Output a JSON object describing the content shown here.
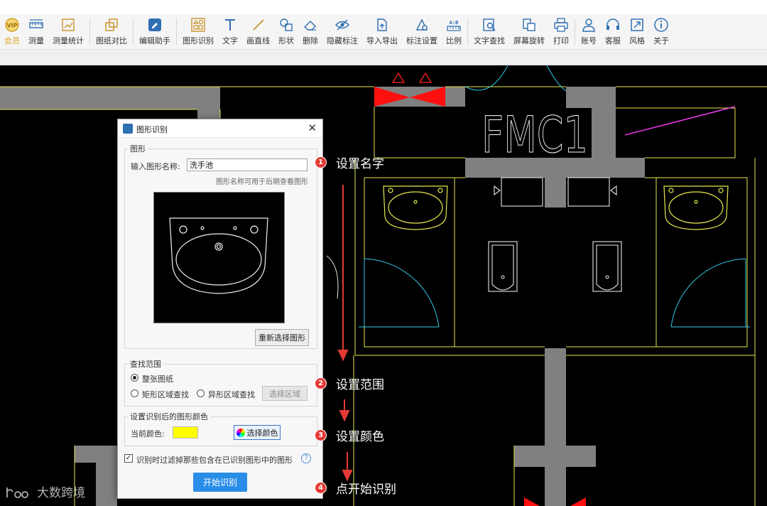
{
  "toolbar": {
    "items": [
      {
        "label": "会员",
        "icon": "vip-icon"
      },
      {
        "label": "测量",
        "icon": "measure-icon"
      },
      {
        "label": "测量统计",
        "icon": "measure-stats-icon"
      },
      {
        "label": "图纸对比",
        "icon": "compare-icon"
      },
      {
        "label": "编辑助手",
        "icon": "edit-assistant-icon"
      },
      {
        "label": "图形识别",
        "icon": "shape-recognition-icon"
      },
      {
        "label": "文字",
        "icon": "text-icon"
      },
      {
        "label": "画直线",
        "icon": "line-icon"
      },
      {
        "label": "形状",
        "icon": "shape-icon"
      },
      {
        "label": "删除",
        "icon": "eraser-icon"
      },
      {
        "label": "隐藏标注",
        "icon": "hide-icon"
      },
      {
        "label": "导入导出",
        "icon": "import-export-icon"
      },
      {
        "label": "标注设置",
        "icon": "annotation-settings-icon"
      },
      {
        "label": "比例",
        "icon": "scale-icon"
      },
      {
        "label": "文字查找",
        "icon": "text-search-icon"
      },
      {
        "label": "屏幕旋转",
        "icon": "rotate-screen-icon"
      },
      {
        "label": "打印",
        "icon": "print-icon"
      },
      {
        "label": "账号",
        "icon": "account-icon"
      },
      {
        "label": "客服",
        "icon": "headset-icon"
      },
      {
        "label": "风格",
        "icon": "style-icon"
      },
      {
        "label": "关于",
        "icon": "info-icon"
      }
    ],
    "accent": "#2f6fb3"
  },
  "drawing": {
    "room_label": "FMC1"
  },
  "dialog": {
    "title": "图形识别",
    "shape_group_legend": "图形",
    "name_label": "输入图形名称:",
    "name_value": "洗手池",
    "name_hint": "图形名称可用于后期查看图形",
    "reselect_button": "重新选择图形",
    "scope_legend": "查找范围",
    "scope_options": [
      {
        "label": "整张图纸",
        "selected": true
      },
      {
        "label": "矩形区域查找",
        "selected": false
      },
      {
        "label": "异形区域查找",
        "selected": false
      }
    ],
    "select_area_button": "选择区域",
    "color_legend": "设置识别后的图形颜色",
    "current_color_label": "当前颜色:",
    "current_color": "#ffff00",
    "pick_color_button": "选择颜色",
    "filter_label": "识别时过滤掉那些包含在已识别图形中的图形",
    "filter_checked": true,
    "start_button": "开始识别"
  },
  "steps": [
    {
      "num": "1",
      "text": "设置名字"
    },
    {
      "num": "2",
      "text": "设置范围"
    },
    {
      "num": "3",
      "text": "设置颜色"
    },
    {
      "num": "4",
      "text": "点开始识别"
    }
  ],
  "step_color": "#e53935",
  "watermark": "大数跨境"
}
